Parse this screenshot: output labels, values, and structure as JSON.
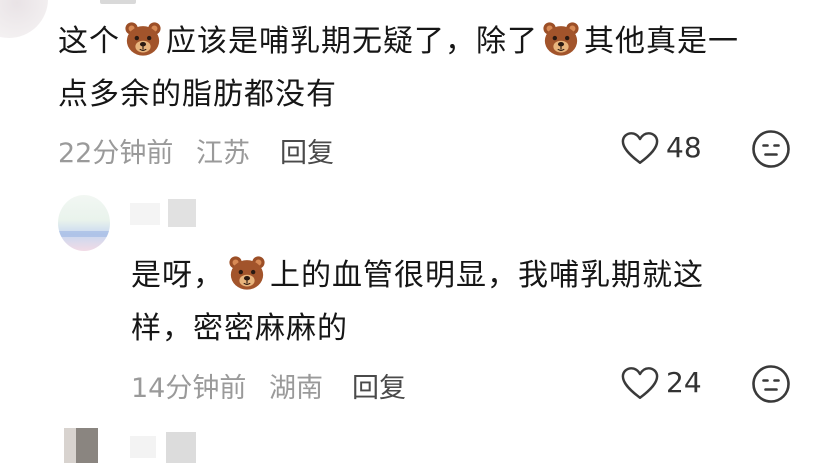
{
  "comments": [
    {
      "text_parts": [
        "这个",
        "应该是哺乳期无疑了，除了",
        "其他真是一"
      ],
      "line2": "点多余的脂肪都没有",
      "emoji": "bear-face",
      "time": "22分钟前",
      "location": "江苏",
      "reply_label": "回复",
      "likes": "48"
    },
    {
      "text_parts": [
        "是呀，",
        "上的血管很明显，我哺乳期就这"
      ],
      "line2": "样，密密麻麻的",
      "emoji": "bear-face",
      "time": "14分钟前",
      "location": "湖南",
      "reply_label": "回复",
      "likes": "24"
    }
  ],
  "colors": {
    "text": "#161616",
    "meta": "#9a9a9a",
    "bear_fur": "#a2542b",
    "bear_muzzle": "#e8b47c"
  }
}
